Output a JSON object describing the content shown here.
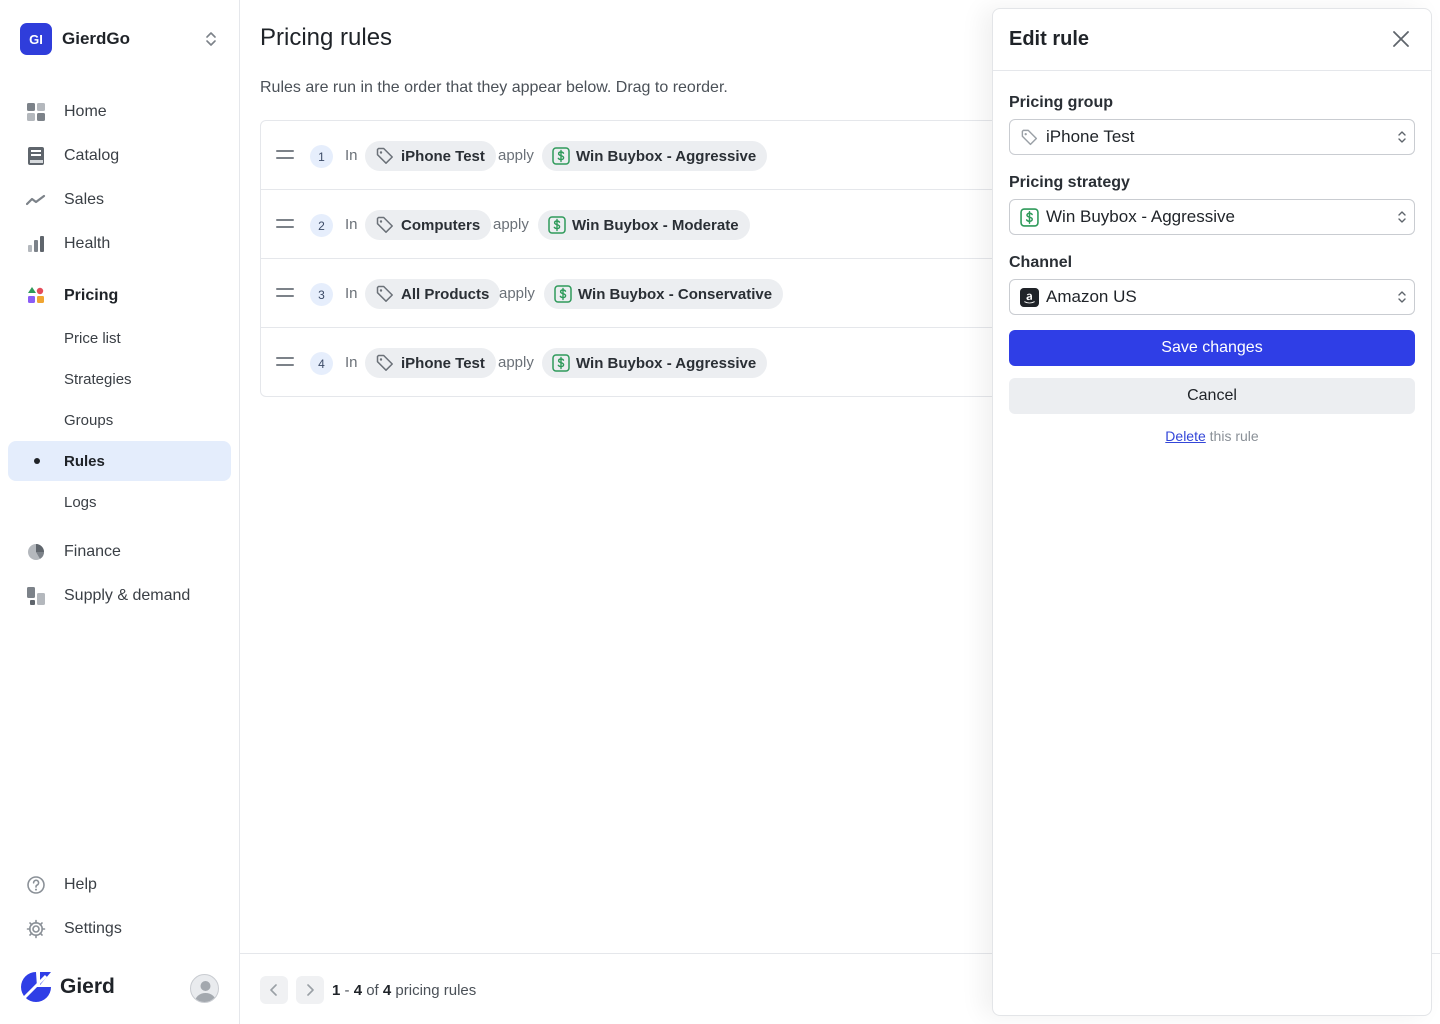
{
  "workspace": {
    "initials": "GI",
    "name": "GierdGo"
  },
  "nav": {
    "home": "Home",
    "catalog": "Catalog",
    "sales": "Sales",
    "health": "Health",
    "pricing": "Pricing",
    "pricing_sub": [
      "Price list",
      "Strategies",
      "Groups",
      "Rules",
      "Logs"
    ],
    "finance": "Finance",
    "supply": "Supply & demand",
    "help": "Help",
    "settings": "Settings"
  },
  "brand": {
    "name": "Gierd"
  },
  "page": {
    "title": "Pricing rules",
    "subtitle": "Rules are run in the order that they appear below. Drag to reorder."
  },
  "rules": [
    {
      "index": "1",
      "in": "In",
      "group": "iPhone Test",
      "apply": "apply",
      "strategy": "Win Buybox - Aggressive"
    },
    {
      "index": "2",
      "in": "In",
      "group": "Computers",
      "apply": "apply",
      "strategy": "Win Buybox - Moderate"
    },
    {
      "index": "3",
      "in": "In",
      "group": "All Products",
      "apply": "apply",
      "strategy": "Win Buybox - Conservative"
    },
    {
      "index": "4",
      "in": "In",
      "group": "iPhone Test",
      "apply": "apply",
      "strategy": "Win Buybox - Aggressive"
    }
  ],
  "pagination": {
    "start": "1",
    "end": "4",
    "total": "4",
    "sep": "-",
    "of": "of",
    "suffix": "pricing rules"
  },
  "panel": {
    "title": "Edit rule",
    "group_label": "Pricing group",
    "group_value": "iPhone Test",
    "strategy_label": "Pricing strategy",
    "strategy_value": "Win Buybox - Aggressive",
    "channel_label": "Channel",
    "channel_value": "Amazon US",
    "save": "Save changes",
    "cancel": "Cancel",
    "delete_link": "Delete",
    "delete_rest": "this rule"
  },
  "colors": {
    "accent": "#2f3ee6",
    "active_nav_bg": "#e4edfc",
    "money_green": "#2e9a5a"
  }
}
